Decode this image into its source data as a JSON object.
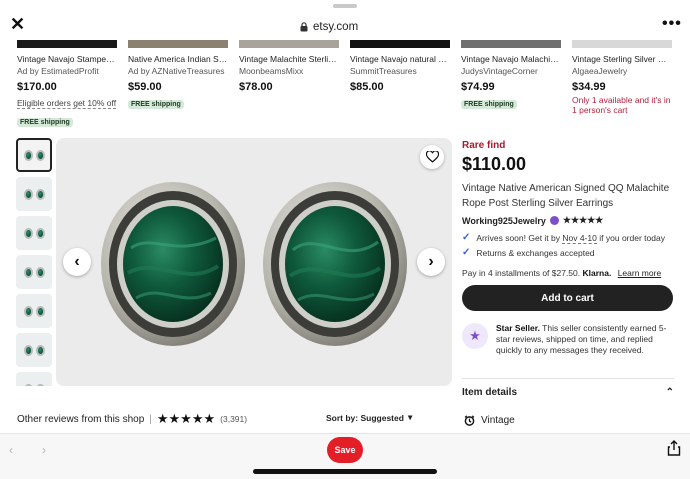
{
  "browser": {
    "url": "etsy.com",
    "save_label": "Save"
  },
  "recommendations": [
    {
      "title": "Vintage Navajo Stamped ...",
      "seller": "Ad by EstimatedProfit",
      "price": "$170.00",
      "note": "Eligible orders get 10% off",
      "badge": "FREE shipping",
      "thumb_color": "#1a1a1a"
    },
    {
      "title": "Native America Indian Ste...",
      "seller": "Ad by AZNativeTreasures",
      "price": "$59.00",
      "badge": "FREE shipping",
      "thumb_color": "#8a8170"
    },
    {
      "title": "Vintage Malachite Sterlin...",
      "seller": "MoonbeamsMixx",
      "price": "$78.00",
      "thumb_color": "#a9a49b"
    },
    {
      "title": "Vintage Navajo natural m...",
      "seller": "SummitTreasures",
      "price": "$85.00",
      "thumb_color": "#111111"
    },
    {
      "title": "Vintage Navajo Malachite ...",
      "seller": "JudysVintageCorner",
      "price": "$74.99",
      "badge": "FREE shipping",
      "thumb_color": "#6f6f6f"
    },
    {
      "title": "Vintage Sterling Silver So...",
      "seller": "AlgaeaJewelry",
      "price": "$34.99",
      "urgency": "Only 1 available and it's in 1 person's cart",
      "thumb_color": "#d8d8d8"
    }
  ],
  "product": {
    "rare": "Rare find",
    "price": "$110.00",
    "title": "Vintage Native American Signed QQ Malachite Rope Post Sterling Silver Earrings",
    "shop": "Working925Jewelry",
    "stars": "★★★★★",
    "delivery_prefix": "Arrives soon! Get it by",
    "delivery_dates": "Nov 4-10",
    "delivery_suffix": "if you order today",
    "returns": "Returns & exchanges accepted",
    "pay_text": "Pay in 4 installments of $27.50.",
    "klarna": "Klarna.",
    "learn_more": "Learn more",
    "cart_label": "Add to cart",
    "star_seller_title": "Star Seller.",
    "star_seller_text": "This seller consistently earned 5-star reviews, shipped on time, and replied quickly to any messages they received.",
    "item_details": "Item details",
    "vintage": "Vintage"
  },
  "reviews": {
    "label": "Other reviews from this shop",
    "separator": "|",
    "stars": "★★★★★",
    "count": "(3,391)",
    "sort": "Sort by: Suggested"
  },
  "colors": {
    "accent_dark": "#222222",
    "rare_red": "#a61a2e",
    "save_red": "#e41e26",
    "free_ship_bg": "#d4e9d7",
    "star_seller_purple": "#7b4fc9"
  },
  "icons": [
    "close-icon",
    "lock-icon",
    "more-icon",
    "heart-icon",
    "chevron-left-icon",
    "chevron-right-icon",
    "check-icon",
    "star-seller-icon",
    "chevron-up-icon",
    "clock-icon",
    "chevron-down-icon",
    "back-icon",
    "forward-icon",
    "share-icon"
  ]
}
